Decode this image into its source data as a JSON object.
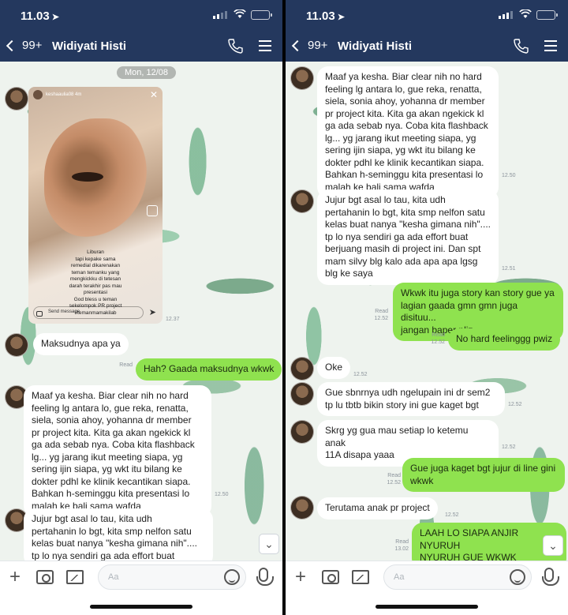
{
  "colors": {
    "header_bg": "#24385e",
    "outgoing_bubble": "#8fe24f",
    "incoming_bubble": "#ffffff"
  },
  "left": {
    "status": {
      "time": "11.03"
    },
    "header": {
      "back_count": "99+",
      "contact_name": "Widiyati Histi"
    },
    "date_pill": "Mon, 12/08",
    "story": {
      "username": "keshaaulia08 4m",
      "caption": "Liburan\ntapi kepake sama\nremedial dikarenakan\nteman temanku yang\nmengkickku di tetesan\ndarah terakhir pas mau\npresentasi\nGod bless u teman\nsekelompok PR project\n#temanmamakilab",
      "send_message": "Send message",
      "time": "12.37"
    },
    "messages": [
      {
        "dir": "in",
        "text": "Maksudnya apa ya"
      },
      {
        "dir": "out",
        "text": "Hah? Gaada maksudnya wkwk",
        "meta": "Read"
      },
      {
        "dir": "in",
        "text": "Maaf ya kesha. Biar clear nih no hard\nfeeling lg antara lo, gue reka,  renatta,\nsiela, sonia ahoy, yohanna dr member\npr project kita. Kita ga akan ngekick kl\nga ada sebab nya. Coba kita flashback\nlg... yg jarang ikut meeting siapa, yg\nsering ijin siapa, yg wkt itu bilang ke\ndokter pdhl ke klinik kecantikan siapa.\nBahkan h-seminggu kita presentasi lo\nmalah ke bali sama wafda",
        "meta": "12.50"
      },
      {
        "dir": "in",
        "text": "Jujur bgt asal lo tau, kita udh\npertahanin lo bgt, kita smp nelfon satu\nkelas buat nanya \"kesha gimana nih\"....\ntp lo nya sendiri ga ada effort buat"
      }
    ],
    "input_placeholder": "Aa"
  },
  "right": {
    "status": {
      "time": "11.03"
    },
    "header": {
      "back_count": "99+",
      "contact_name": "Widiyati Histi"
    },
    "messages": [
      {
        "dir": "in",
        "text": "Maaf ya kesha. Biar clear nih no hard\nfeeling lg antara lo, gue reka,  renatta,\nsiela, sonia ahoy, yohanna dr member\npr project kita. Kita ga akan ngekick kl\nga ada sebab nya. Coba kita flashback\nlg... yg jarang ikut meeting siapa, yg\nsering ijin siapa, yg wkt itu bilang ke\ndokter pdhl ke klinik kecantikan siapa.\nBahkan h-seminggu kita presentasi lo\nmalah ke bali sama wafda",
        "meta": "12.50"
      },
      {
        "dir": "in",
        "text": "Jujur bgt asal lo tau, kita udh\npertahanin lo bgt, kita smp nelfon satu\nkelas buat nanya \"kesha gimana nih\"....\ntp lo nya sendiri ga ada effort buat\nberjuang masih di project ini. Dan spt\nmam silvy blg kalo ada apa apa lgsg\nblg ke saya",
        "meta": "12.51"
      },
      {
        "dir": "out",
        "text": "Wkwk itu juga story kan story gue ya\nlagian gaada gmn gmn juga disituu...\njangan baper pliz",
        "meta": "Read\n12.52"
      },
      {
        "dir": "out",
        "text": "No hard feelinggg pwiz",
        "meta": "Read\n12.52"
      },
      {
        "dir": "in",
        "text": "Oke",
        "meta": "12.52"
      },
      {
        "dir": "in",
        "text": "Gue sbnrnya udh ngelupain ini dr sem2\ntp lu tbtb bikin story ini gue kaget bgt",
        "meta": "12.52"
      },
      {
        "dir": "in",
        "text": "Skrg yg gua mau setiap lo ketemu anak\n11A disapa yaaa",
        "meta": "12.52"
      },
      {
        "dir": "out",
        "text": "Gue juga kaget bgt jujur di line gini\nwkwk",
        "meta": "Read\n12.52"
      },
      {
        "dir": "in",
        "text": "Terutama anak pr project",
        "meta": "12.52"
      },
      {
        "dir": "out",
        "text": "LAAH LO SIAPA ANJIR NYURUH\nNYURUH GUE WKWK",
        "meta": "Read\n13.02"
      }
    ],
    "input_placeholder": "Aa"
  }
}
